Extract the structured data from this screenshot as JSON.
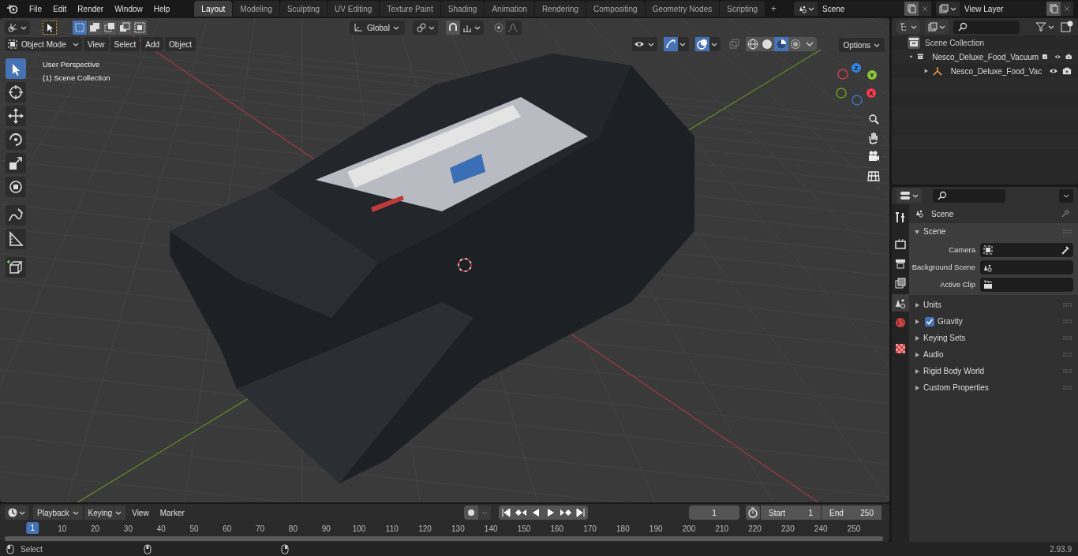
{
  "menu": [
    "File",
    "Edit",
    "Render",
    "Window",
    "Help"
  ],
  "workspaces": [
    {
      "label": "Layout",
      "selected": true
    },
    {
      "label": "Modeling",
      "selected": false
    },
    {
      "label": "Sculpting",
      "selected": false
    },
    {
      "label": "UV Editing",
      "selected": false
    },
    {
      "label": "Texture Paint",
      "selected": false
    },
    {
      "label": "Shading",
      "selected": false
    },
    {
      "label": "Animation",
      "selected": false
    },
    {
      "label": "Rendering",
      "selected": false
    },
    {
      "label": "Compositing",
      "selected": false
    },
    {
      "label": "Geometry Nodes",
      "selected": false
    },
    {
      "label": "Scripting",
      "selected": false
    }
  ],
  "add_workspace": "+",
  "scene_field": "Scene",
  "view_layer_field": "View Layer",
  "viewport": {
    "select_modes": [
      {
        "kind": "box",
        "selected": true
      },
      {
        "kind": "extend",
        "selected": false
      },
      {
        "kind": "subtract",
        "selected": false
      },
      {
        "kind": "difference",
        "selected": false
      },
      {
        "kind": "intersect",
        "selected": false
      }
    ],
    "mode": "Object Mode",
    "menus": [
      "View",
      "Select",
      "Add",
      "Object"
    ],
    "orientation": "Global",
    "options": "Options",
    "shading": [
      {
        "kind": "wireframe",
        "selected": false
      },
      {
        "kind": "solid",
        "selected": false
      },
      {
        "kind": "material",
        "selected": true
      },
      {
        "kind": "rendered",
        "selected": false
      }
    ],
    "overlay_text": [
      "User Perspective",
      "(1) Scene Collection"
    ],
    "tools": [
      {
        "kind": "select",
        "selected": true
      },
      {
        "kind": "cursor",
        "selected": false
      },
      {
        "kind": "move",
        "selected": false
      },
      {
        "kind": "rotate",
        "selected": false
      },
      {
        "kind": "scale",
        "selected": false
      },
      {
        "kind": "transform",
        "selected": false
      },
      {
        "kind": "annotate",
        "selected": false
      },
      {
        "kind": "measure",
        "selected": false
      },
      {
        "kind": "add-cube",
        "selected": false
      }
    ],
    "gizmo_axes": [
      {
        "kind": "negative",
        "color": "#cb3d4e"
      },
      {
        "kind": "negative",
        "color": "#6b9a1f"
      },
      {
        "kind": "negative",
        "color": "#3b72b8"
      },
      {
        "kind": "positive",
        "label": "Z",
        "color": "#2f83e3"
      },
      {
        "kind": "positive",
        "label": "Y",
        "color": "#8bc43b"
      },
      {
        "kind": "positive",
        "label": "X",
        "color": "#f03c4f"
      }
    ]
  },
  "outliner": {
    "root": "Scene Collection",
    "items": [
      {
        "label": "Nesco_Deluxe_Food_Vacuum",
        "kind": "collection",
        "expanded": true,
        "checked": true,
        "children": [
          {
            "label": "Nesco_Deluxe_Food_Vac",
            "kind": "empty",
            "expanded": false
          }
        ]
      }
    ]
  },
  "properties": {
    "tabs": [
      {
        "kind": "tool",
        "selected": false
      },
      {
        "kind": "render",
        "selected": false
      },
      {
        "kind": "output",
        "selected": false
      },
      {
        "kind": "view-layer",
        "selected": false
      },
      {
        "kind": "scene",
        "selected": true
      },
      {
        "kind": "world",
        "selected": false
      },
      {
        "kind": "texture",
        "selected": false
      }
    ],
    "context": "Scene",
    "panels": [
      {
        "title": "Scene",
        "expanded": true,
        "fields": [
          {
            "label": "Camera",
            "kind": "camera"
          },
          {
            "label": "Background Scene",
            "kind": "scene"
          },
          {
            "label": "Active Clip",
            "kind": "clip"
          }
        ]
      },
      {
        "title": "Units",
        "expanded": false
      },
      {
        "title": "Gravity",
        "expanded": false,
        "checked": true
      },
      {
        "title": "Keying Sets",
        "expanded": false
      },
      {
        "title": "Audio",
        "expanded": false
      },
      {
        "title": "Rigid Body World",
        "expanded": false
      },
      {
        "title": "Custom Properties",
        "expanded": false
      }
    ]
  },
  "timeline": {
    "dropdowns": [
      "Playback",
      "Keying"
    ],
    "menus": [
      "View",
      "Marker"
    ],
    "current_frame": "1",
    "start_label": "Start",
    "start": "1",
    "end_label": "End",
    "end": "250",
    "playhead": "1",
    "ticks": [
      "10",
      "20",
      "30",
      "40",
      "50",
      "60",
      "70",
      "80",
      "90",
      "100",
      "110",
      "120",
      "130",
      "140",
      "150",
      "160",
      "170",
      "180",
      "190",
      "200",
      "210",
      "220",
      "230",
      "240",
      "250"
    ]
  },
  "status_bar": {
    "hint": "Select",
    "version": "2.93.9"
  }
}
